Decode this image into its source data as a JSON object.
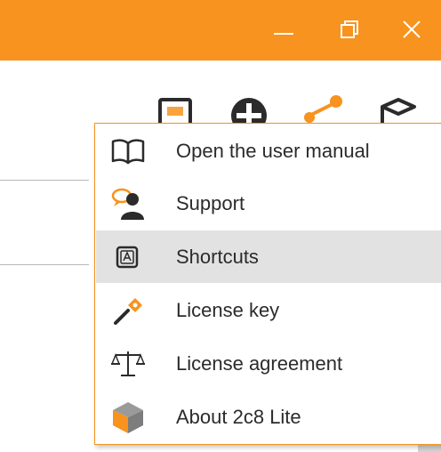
{
  "window": {
    "controls": [
      {
        "name": "minimize-button",
        "icon": "minimize-icon"
      },
      {
        "name": "restore-button",
        "icon": "restore-icon"
      },
      {
        "name": "close-button",
        "icon": "close-icon"
      }
    ],
    "titlebar_color": "#f7931e"
  },
  "toolbar": {
    "icons": [
      "window-icon",
      "add-icon",
      "share-icon",
      "package-icon"
    ]
  },
  "menu": {
    "border_color": "#f7931e",
    "selected_index": 2,
    "items": [
      {
        "label": "Open the user manual",
        "icon": "book-icon"
      },
      {
        "label": "Support",
        "icon": "support-icon"
      },
      {
        "label": "Shortcuts",
        "icon": "keyboard-key-icon"
      },
      {
        "label": "License key",
        "icon": "key-icon"
      },
      {
        "label": "License agreement",
        "icon": "scales-icon"
      },
      {
        "label": "About 2c8 Lite",
        "icon": "cube-logo-icon"
      }
    ]
  }
}
